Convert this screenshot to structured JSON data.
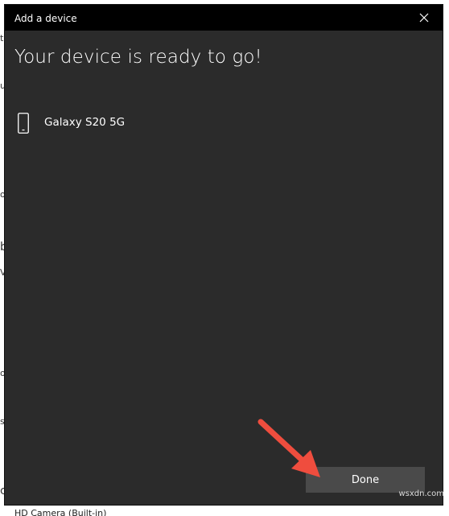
{
  "dialog": {
    "title": "Add a device",
    "heading": "Your device is ready to go!",
    "close_icon": "close-icon",
    "device": {
      "icon": "phone-icon",
      "name": "Galaxy S20 5G"
    },
    "done_label": "Done"
  },
  "annotation": {
    "arrow_color": "#ef4d3e"
  },
  "background_window": {
    "bottom_fragment": "HD Camera (Built-in)",
    "fragments": [
      "t",
      "ue",
      "ol",
      "b",
      "V",
      "o",
      "s",
      "c"
    ]
  },
  "watermark": "wsxdn.com",
  "colors": {
    "titlebar": "#000000",
    "dialog_bg": "#2b2b2b",
    "button_bg": "#4a4a4a",
    "text": "#ffffff"
  }
}
